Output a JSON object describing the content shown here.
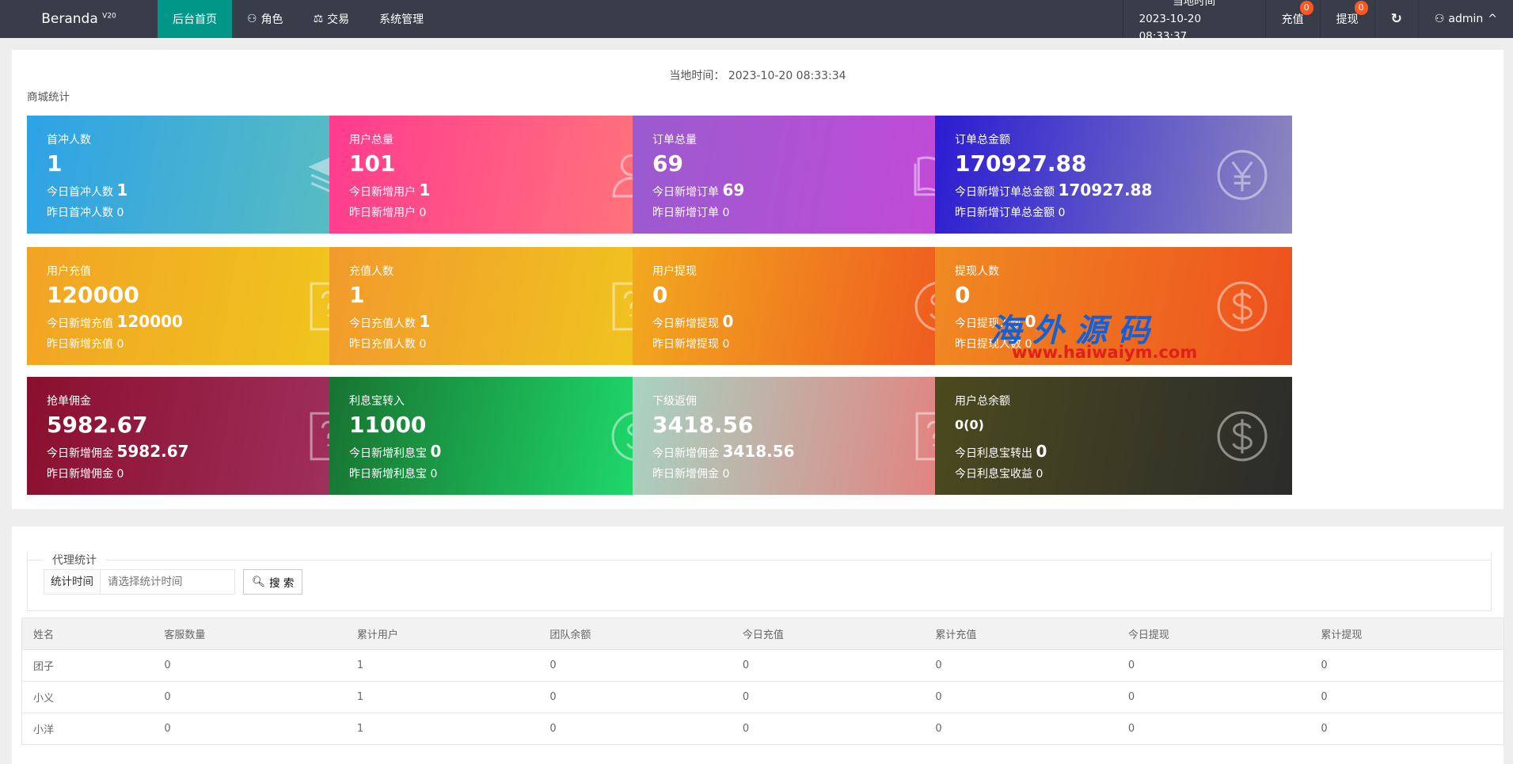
{
  "header": {
    "logo": "Beranda",
    "version": "V20",
    "nav": [
      "后台首页",
      "角色",
      "交易",
      "系统管理"
    ],
    "time_label": "当地时间",
    "time_value": "2023-10-20 08:33:37",
    "recharge": "充值",
    "recharge_badge": "0",
    "withdraw": "提现",
    "withdraw_badge": "0",
    "user": "admin"
  },
  "stats": {
    "local_time": "当地时间：  2023-10-20 08:33:34",
    "title": "商城统计",
    "cards": [
      {
        "title": "首冲人数",
        "value": "1",
        "today_label": "今日首冲人数",
        "today": "1",
        "yesterday": "昨日首冲人数  0",
        "icon": "layers-icon",
        "colors": [
          "#2ea2e6",
          "#5dc0bd"
        ]
      },
      {
        "title": "用户总量",
        "value": "101",
        "today_label": "今日新增用户",
        "today": "1",
        "yesterday": "昨日新增用户  0",
        "icon": "users-icon",
        "colors": [
          "#ff3b8f",
          "#ff7c78"
        ]
      },
      {
        "title": "订单总量",
        "value": "69",
        "today_label": "今日新增订单",
        "today": "69",
        "yesterday": "昨日新增订单  0",
        "icon": "book-icon",
        "colors": [
          "#9a5bcf",
          "#c847d9"
        ]
      },
      {
        "title": "订单总金额",
        "value": "170927.88",
        "today_label": "今日新增订单总金额",
        "today": "170927.88",
        "yesterday": "昨日新增订单总金额  0",
        "icon": "yen-icon",
        "colors": [
          "#2a1cd2",
          "#8d88bf"
        ]
      },
      {
        "title": "用户充值",
        "value": "120000",
        "today_label": "今日新增充值",
        "today": "120000",
        "yesterday": "昨日新增充值  0",
        "icon": "edit-question-icon",
        "colors": [
          "#f2a325",
          "#efcb1c"
        ]
      },
      {
        "title": "充值人数",
        "value": "1",
        "today_label": "今日充值人数",
        "today": "1",
        "yesterday": "昨日充值人数  0",
        "icon": "edit-question-icon",
        "colors": [
          "#f29a2c",
          "#efca1d"
        ]
      },
      {
        "title": "用户提现",
        "value": "0",
        "today_label": "今日新增提现",
        "today": "0",
        "yesterday": "昨日新增提现  0",
        "icon": "dollar-icon",
        "colors": [
          "#f2a91f",
          "#ee4f1f"
        ]
      },
      {
        "title": "提现人数",
        "value": "0",
        "today_label": "今日提现人数",
        "today": "0",
        "yesterday": "昨日提现人数  0",
        "icon": "dollar-icon",
        "colors": [
          "#f08a21",
          "#ed501e"
        ]
      },
      {
        "title": "抢单佣金",
        "value": "5982.67",
        "today_label": "今日新增佣金",
        "today": "5982.67",
        "yesterday": "昨日新增佣金  0",
        "icon": "edit-question-icon",
        "colors": [
          "#8a0f2e",
          "#a23463"
        ]
      },
      {
        "title": "利息宝转入",
        "value": "11000",
        "today_label": "今日新增利息宝",
        "today": "0",
        "yesterday": "昨日新增利息宝  0",
        "icon": "dollar-icon",
        "colors": [
          "#187330",
          "#1fe873"
        ]
      },
      {
        "title": "下级返佣",
        "value": "3418.56",
        "today_label": "今日新增佣金",
        "today": "3418.56",
        "yesterday": "昨日新增佣金  0",
        "icon": "edit-question-icon",
        "colors": [
          "#a8d3c2",
          "#ec7676"
        ]
      },
      {
        "title": "用户总余额",
        "value": "0(0)",
        "today_label": "今日利息宝转出",
        "today": "0",
        "yesterday": "今日利息宝收益  0",
        "icon": "dollar-icon",
        "colors": [
          "#4b4a1e",
          "#2b2b2b"
        ]
      }
    ]
  },
  "watermark": {
    "text": "海外源码",
    "url": "www.haiwaiym.com"
  },
  "agent": {
    "legend": "代理统计",
    "time_label": "统计时间",
    "time_placeholder": "请选择统计时间",
    "search": "搜 索",
    "columns": [
      "姓名",
      "客服数量",
      "累计用户",
      "团队余额",
      "今日充值",
      "累计充值",
      "今日提现",
      "累计提现"
    ],
    "rows": [
      [
        "团子",
        "0",
        "1",
        "0",
        "0",
        "0",
        "0",
        "0"
      ],
      [
        "小义",
        "0",
        "1",
        "0",
        "0",
        "0",
        "0",
        "0"
      ],
      [
        "小洋",
        "0",
        "1",
        "0",
        "0",
        "0",
        "0",
        "0"
      ]
    ]
  }
}
